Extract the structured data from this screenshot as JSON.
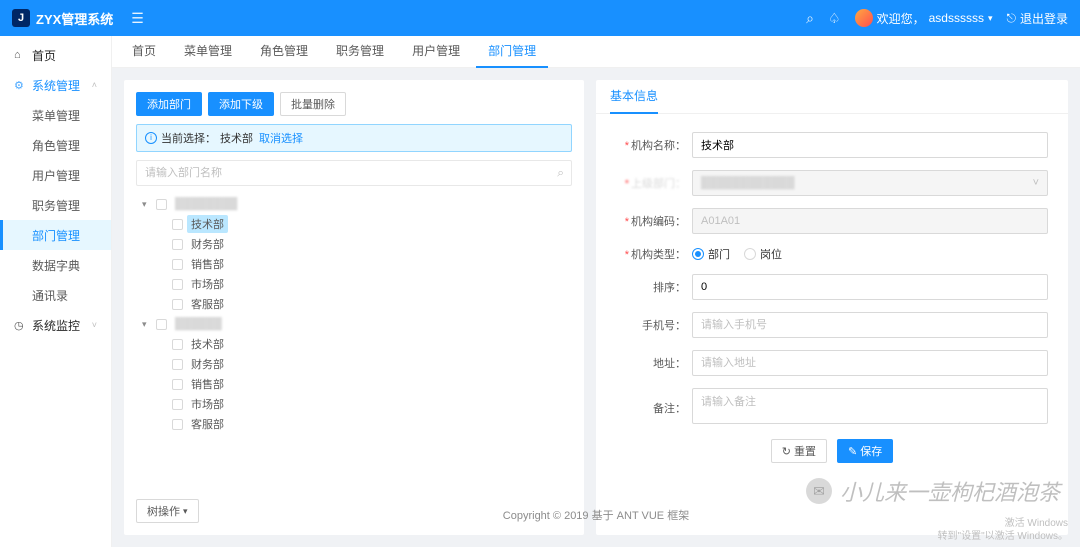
{
  "brand": {
    "badge": "J",
    "title": "ZYX管理系统"
  },
  "header": {
    "welcome_prefix": "欢迎您，",
    "username": "asdssssss",
    "logout": "退出登录"
  },
  "sidemenu": {
    "home": "首页",
    "system_mgmt": "系统管理",
    "items": [
      "菜单管理",
      "角色管理",
      "用户管理",
      "职务管理",
      "部门管理",
      "数据字典",
      "通讯录"
    ],
    "system_monitor": "系统监控"
  },
  "tabs": [
    "首页",
    "菜单管理",
    "角色管理",
    "职务管理",
    "用户管理",
    "部门管理"
  ],
  "left": {
    "buttons": {
      "add_dept": "添加部门",
      "add_sub": "添加下级",
      "batch_del": "批量删除"
    },
    "selection_bar": {
      "prefix": "当前选择：",
      "value": "技术部",
      "clear": "取消选择"
    },
    "search_placeholder": "请输入部门名称",
    "tree": {
      "root1_blur": "████████",
      "root1_children": [
        "技术部",
        "财务部",
        "销售部",
        "市场部",
        "客服部"
      ],
      "root2_blur": "██████",
      "root2_children": [
        "技术部",
        "财务部",
        "销售部",
        "市场部",
        "客服部"
      ]
    },
    "tree_ops": "树操作"
  },
  "right": {
    "panel_title": "基本信息",
    "fields": {
      "org_name": {
        "label": "机构名称：",
        "value": "技术部"
      },
      "parent": {
        "label_blur": "上级部门：",
        "value_blur": "████████████"
      },
      "org_code": {
        "label": "机构编码：",
        "value": "A01A01"
      },
      "org_type": {
        "label": "机构类型：",
        "opt_dept": "部门",
        "opt_pos": "岗位"
      },
      "sort": {
        "label": "排序：",
        "value": "0"
      },
      "phone": {
        "label": "手机号：",
        "placeholder": "请输入手机号"
      },
      "address": {
        "label": "地址：",
        "placeholder": "请输入地址"
      },
      "remark": {
        "label": "备注：",
        "placeholder": "请输入备注"
      }
    },
    "actions": {
      "reset": "重置",
      "save": "保存"
    }
  },
  "footer": "Copyright © 2019 基于 ANT VUE 框架",
  "watermark": "小儿来一壶枸杞酒泡茶",
  "activate": {
    "l1": "激活 Windows",
    "l2": "转到\"设置\"以激活 Windows。"
  }
}
